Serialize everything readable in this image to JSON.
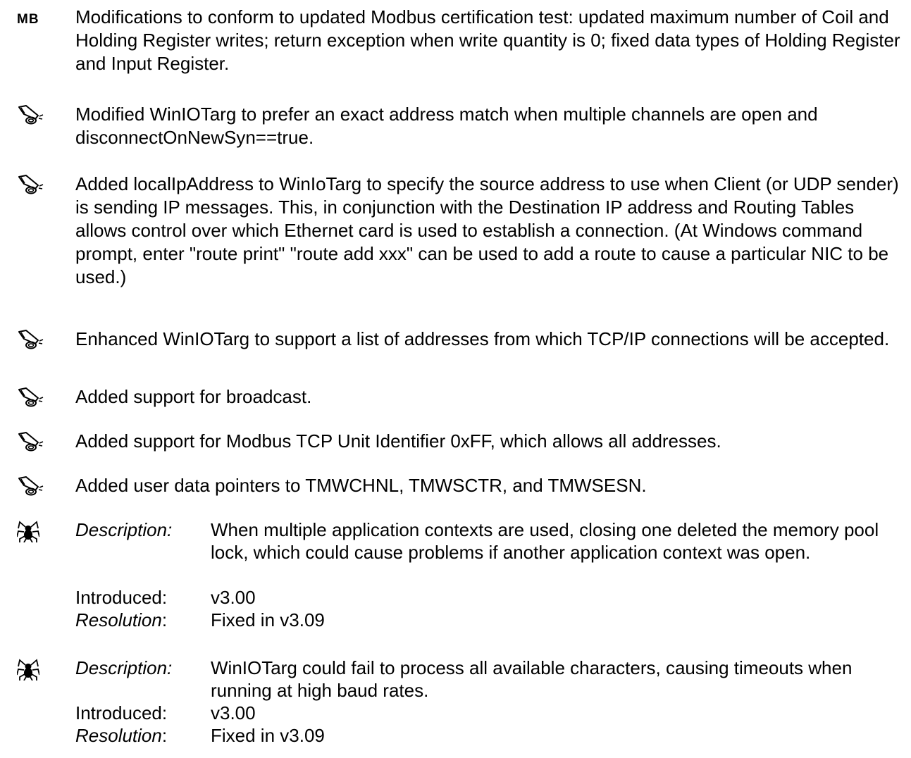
{
  "tag_mb": "MB",
  "items": [
    {
      "text": "Modifications to conform to updated Modbus certification test: updated maximum number of Coil and Holding Register writes; return exception when write quantity is 0; fixed data types of Holding Register and Input Register."
    },
    {
      "text": "Modified WinIOTarg to prefer an exact address match when multiple channels are open and disconnectOnNewSyn==true."
    },
    {
      "text": "Added localIpAddress to WinIoTarg to specify the source address to use when Client (or UDP sender) is sending IP messages. This, in conjunction with the Destination IP address and Routing Tables allows control over which Ethernet card is used to establish a connection. (At Windows command prompt, enter \"route print\" \"route add xxx\" can be used to add a route to cause a particular NIC to be used.)"
    },
    {
      "text": "Enhanced WinIOTarg to support a list of addresses from which TCP/IP connections will be accepted."
    },
    {
      "text": "Added support for broadcast."
    },
    {
      "text": "Added support for Modbus TCP Unit Identifier 0xFF, which allows all addresses."
    },
    {
      "text": "Added user data pointers to TMWCHNL, TMWSCTR, and TMWSESN."
    }
  ],
  "labels": {
    "description": "Description:",
    "introduced": "Introduced:",
    "resolution": "Resolution",
    "colon": ":"
  },
  "bugs": [
    {
      "description": "When multiple application contexts are used, closing one deleted the memory pool lock, which could cause problems if another application context was open.",
      "introduced": "v3.00",
      "resolution": "Fixed in v3.09"
    },
    {
      "description": "WinIOTarg could fail to process all available characters, causing timeouts when running at high baud rates.",
      "introduced": "v3.00",
      "resolution": "Fixed in v3.09"
    }
  ]
}
